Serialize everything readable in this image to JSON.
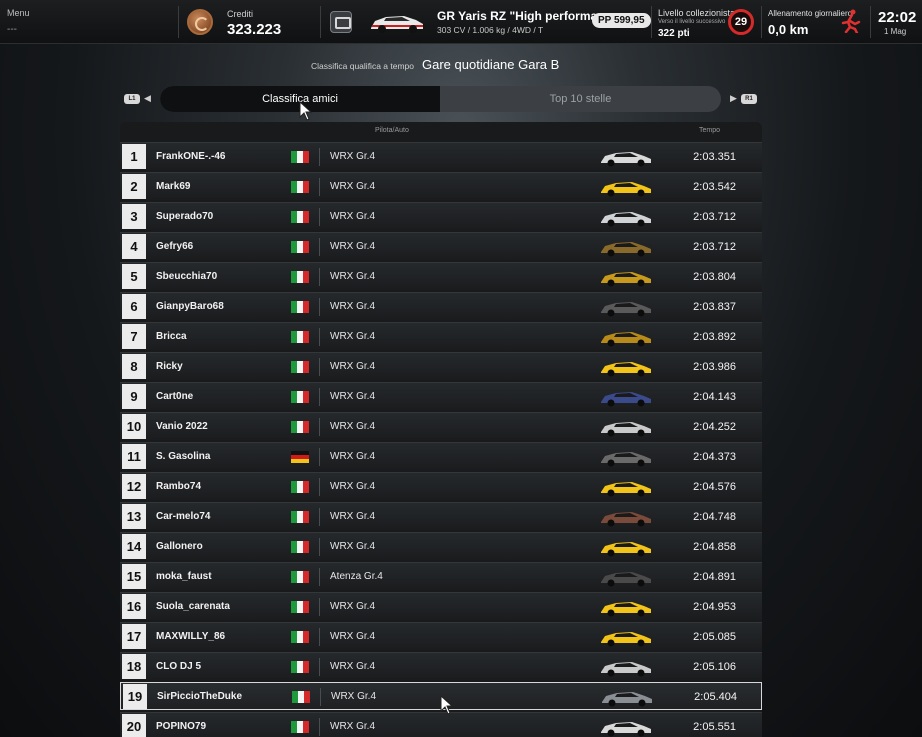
{
  "topbar": {
    "menu_label": "Menu",
    "menu_sub": "---",
    "credits_label": "Crediti",
    "credits_value": "323.223",
    "car_name": "GR Yaris RZ \"High performa...",
    "car_specs": "303 CV / 1.006 kg / 4WD / T",
    "pp_value": "PP 599,95",
    "collector_label": "Livello collezionista",
    "collector_sub": "Verso il livello successivo",
    "collector_points": "322 pti",
    "collector_level": "29",
    "training_label": "Allenamento giornaliero",
    "training_value": "0,0 km",
    "clock_time": "22:02",
    "clock_date": "1 Mag"
  },
  "header": {
    "subtitle": "Classifica qualifica a tempo",
    "title": "Gare quotidiane Gara B"
  },
  "tabs": {
    "left_button": "L1",
    "right_button": "R1",
    "active": "Classifica amici",
    "inactive": "Top 10 stelle"
  },
  "table": {
    "col_driver": "Pilota/Auto",
    "col_time": "Tempo",
    "rows": [
      {
        "rank": "1",
        "name": "FrankONE-.-46",
        "flag": "it",
        "car": "WRX Gr.4",
        "livery": "#d9d9d9",
        "time": "2:03.351"
      },
      {
        "rank": "2",
        "name": "Mark69",
        "flag": "it",
        "car": "WRX Gr.4",
        "livery": "#f2c319",
        "time": "2:03.542"
      },
      {
        "rank": "3",
        "name": "Superado70",
        "flag": "it",
        "car": "WRX Gr.4",
        "livery": "#cfd3d6",
        "time": "2:03.712"
      },
      {
        "rank": "4",
        "name": "Gefry66",
        "flag": "it",
        "car": "WRX Gr.4",
        "livery": "#8a6a2a",
        "time": "2:03.712"
      },
      {
        "rank": "5",
        "name": "Sbeucchia70",
        "flag": "it",
        "car": "WRX Gr.4",
        "livery": "#c79a1e",
        "time": "2:03.804"
      },
      {
        "rank": "6",
        "name": "GianpyBaro68",
        "flag": "it",
        "car": "WRX Gr.4",
        "livery": "#5a5a5a",
        "time": "2:03.837"
      },
      {
        "rank": "7",
        "name": "Bricca",
        "flag": "it",
        "car": "WRX Gr.4",
        "livery": "#b88a1a",
        "time": "2:03.892"
      },
      {
        "rank": "8",
        "name": "Ricky",
        "flag": "it",
        "car": "WRX Gr.4",
        "livery": "#f2c319",
        "time": "2:03.986"
      },
      {
        "rank": "9",
        "name": "Cart0ne",
        "flag": "it",
        "car": "WRX Gr.4",
        "livery": "#3a4a8a",
        "time": "2:04.143"
      },
      {
        "rank": "10",
        "name": "Vanio 2022",
        "flag": "it",
        "car": "WRX Gr.4",
        "livery": "#c9c9c9",
        "time": "2:04.252"
      },
      {
        "rank": "11",
        "name": "S. Gasolina",
        "flag": "de",
        "car": "WRX Gr.4",
        "livery": "#6a6a6a",
        "time": "2:04.373"
      },
      {
        "rank": "12",
        "name": "Rambo74",
        "flag": "it",
        "car": "WRX Gr.4",
        "livery": "#f2c319",
        "time": "2:04.576"
      },
      {
        "rank": "13",
        "name": "Car-melo74",
        "flag": "it",
        "car": "WRX Gr.4",
        "livery": "#7a4a3a",
        "time": "2:04.748"
      },
      {
        "rank": "14",
        "name": "Gallonero",
        "flag": "it",
        "car": "WRX Gr.4",
        "livery": "#f2c319",
        "time": "2:04.858"
      },
      {
        "rank": "15",
        "name": "moka_faust",
        "flag": "it",
        "car": "Atenza Gr.4",
        "livery": "#4a4a4a",
        "time": "2:04.891"
      },
      {
        "rank": "16",
        "name": "Suola_carenata",
        "flag": "it",
        "car": "WRX Gr.4",
        "livery": "#f2c319",
        "time": "2:04.953"
      },
      {
        "rank": "17",
        "name": "MAXWILLY_86",
        "flag": "it",
        "car": "WRX Gr.4",
        "livery": "#f2c319",
        "time": "2:05.085"
      },
      {
        "rank": "18",
        "name": "CLO DJ 5",
        "flag": "it",
        "car": "WRX Gr.4",
        "livery": "#c9c9c9",
        "time": "2:05.106"
      },
      {
        "rank": "19",
        "name": "SirPiccioTheDuke",
        "flag": "it",
        "car": "WRX Gr.4",
        "livery": "#8a8f95",
        "time": "2:05.404"
      },
      {
        "rank": "20",
        "name": "POPINO79",
        "flag": "it",
        "car": "WRX Gr.4",
        "livery": "#d9d9d9",
        "time": "2:05.551"
      }
    ]
  },
  "flags": {
    "it": [
      "#1e9a3c",
      "#f4f4f4",
      "#d42a2a"
    ],
    "de": [
      "#111111",
      "#d01a1a",
      "#f2c319"
    ]
  },
  "selected_rank": "19"
}
